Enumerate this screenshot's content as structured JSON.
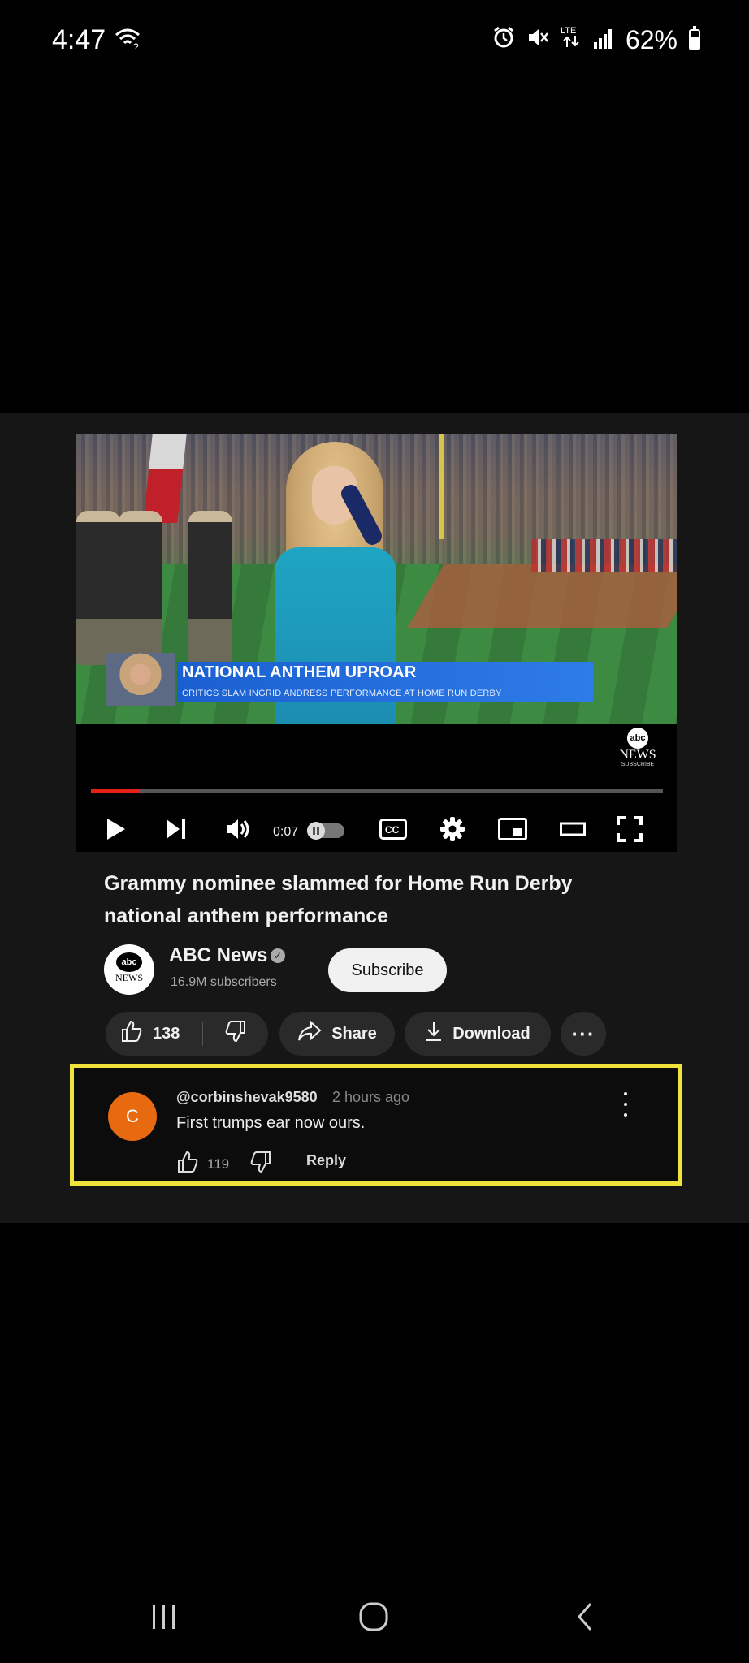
{
  "status_bar": {
    "time": "4:47",
    "wifi_icon": "wifi-question-icon",
    "right_icons": [
      "alarm-icon",
      "mute-icon",
      "lte-icon",
      "signal-icon"
    ],
    "lte_text": "LTE",
    "battery_percent": "62%",
    "battery_level": 0.62
  },
  "video": {
    "lower_third": {
      "headline": "NATIONAL ANTHEM UPROAR",
      "subheadline": "CRITICS SLAM INGRID ANDRESS PERFORMANCE AT HOME RUN DERBY"
    },
    "watermark": {
      "logo": "abc",
      "news": "NEWS",
      "subscribe": "SUBSCRIBE"
    },
    "progress_fraction": 0.085,
    "time_display": "0:07",
    "cc_label": "CC",
    "accent_color": "#e62117"
  },
  "info": {
    "title": "Grammy nominee slammed for Home Run Derby national anthem performance",
    "channel_name": "ABC News",
    "subscribers": "16.9M subscribers",
    "subscribe_label": "Subscribe",
    "avatar_abc": "abc",
    "avatar_news": "NEWS",
    "like_count": "138",
    "share_label": "Share",
    "download_label": "Download",
    "more_label": "···"
  },
  "comment": {
    "avatar_initial": "C",
    "avatar_color": "#e86a10",
    "author": "@corbinshevak9580",
    "time": "2 hours ago",
    "text": "First trumps ear now ours.",
    "like_count": "119",
    "reply_label": "Reply",
    "highlight_color": "#efe33a"
  }
}
